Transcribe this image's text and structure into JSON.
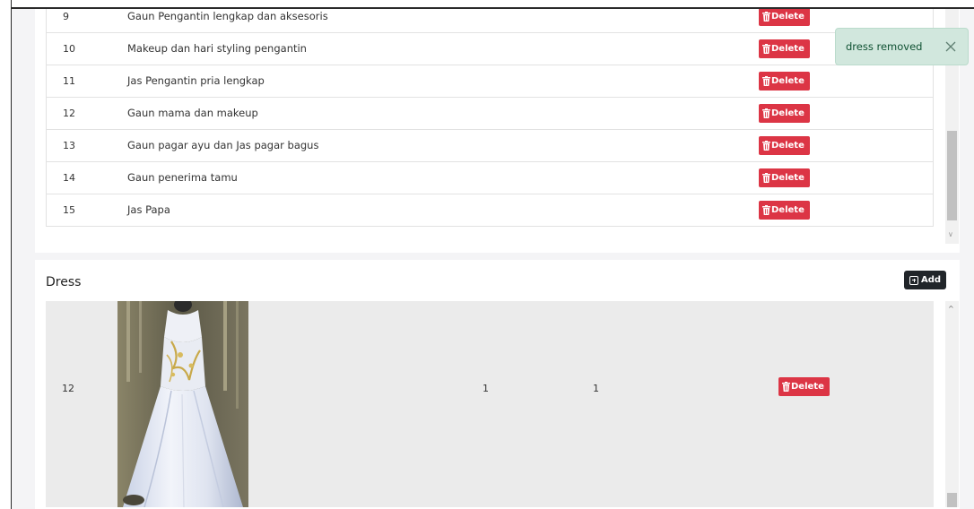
{
  "services_table": {
    "rows": [
      {
        "num": "9",
        "name": "Gaun Pengantin lengkap dan aksesoris",
        "action": "Delete"
      },
      {
        "num": "10",
        "name": "Makeup dan hari styling pengantin",
        "action": "Delete"
      },
      {
        "num": "11",
        "name": "Jas Pengantin pria lengkap",
        "action": "Delete"
      },
      {
        "num": "12",
        "name": "Gaun mama dan makeup",
        "action": "Delete"
      },
      {
        "num": "13",
        "name": "Gaun pagar ayu dan Jas pagar bagus",
        "action": "Delete"
      },
      {
        "num": "14",
        "name": "Gaun penerima tamu",
        "action": "Delete"
      },
      {
        "num": "15",
        "name": "Jas Papa",
        "action": "Delete"
      }
    ]
  },
  "dress_section": {
    "title": "Dress",
    "add_label": "Add",
    "rows": [
      {
        "num": "12",
        "value1": "1",
        "value2": "1",
        "action": "Delete"
      }
    ]
  },
  "toast": {
    "message": "dress removed"
  },
  "colors": {
    "danger": "#dc3545",
    "dark": "#212529",
    "toast_bg": "#d1e7dd",
    "toast_text": "#0f5132"
  },
  "icons": {
    "delete": "trash-icon",
    "add": "plus-box-icon",
    "toast_close": "close-icon"
  }
}
